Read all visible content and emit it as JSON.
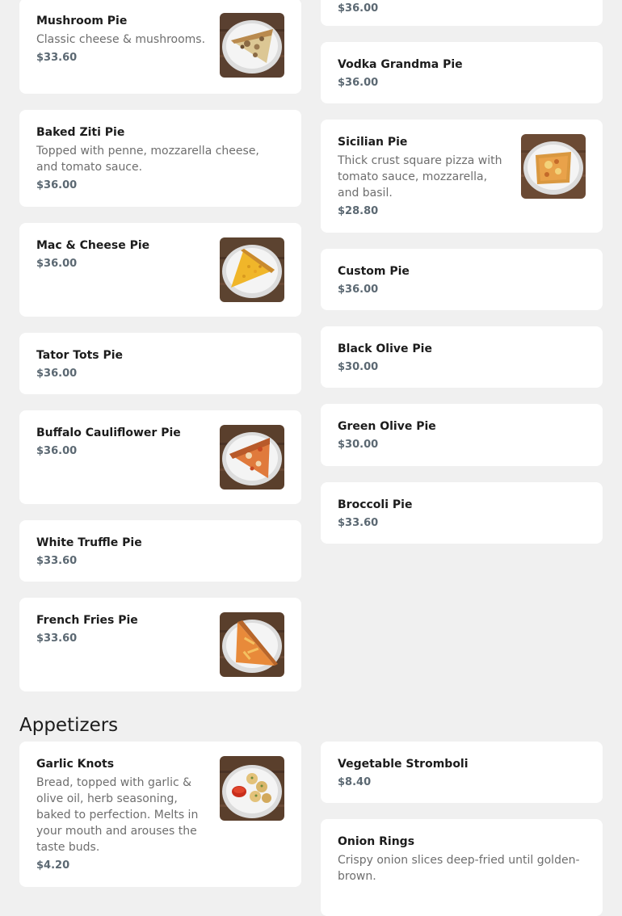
{
  "sections": {
    "pizza": {
      "items": {
        "mushroom": {
          "name": "Mushroom Pie",
          "description": "Classic cheese & mushrooms.",
          "price": "$33.60"
        },
        "baked_ziti": {
          "name": "Baked Ziti Pie",
          "description": "Topped with penne, mozzarella cheese, and tomato sauce.",
          "price": "$36.00"
        },
        "mac_cheese": {
          "name": "Mac & Cheese Pie",
          "price": "$36.00"
        },
        "tator_tots": {
          "name": "Tator Tots Pie",
          "price": "$36.00"
        },
        "buffalo_cauliflower": {
          "name": "Buffalo Cauliflower Pie",
          "price": "$36.00"
        },
        "white_truffle": {
          "name": "White Truffle Pie",
          "price": "$33.60"
        },
        "french_fries": {
          "name": "French Fries Pie",
          "price": "$33.60"
        },
        "partial_top_card": {
          "price": "$36.00"
        },
        "vodka_grandma": {
          "name": "Vodka Grandma Pie",
          "price": "$36.00"
        },
        "sicilian": {
          "name": "Sicilian Pie",
          "description": "Thick crust square pizza with tomato sauce, mozzarella, and basil.",
          "price": "$28.80"
        },
        "custom": {
          "name": "Custom Pie",
          "price": "$36.00"
        },
        "black_olive": {
          "name": "Black Olive Pie",
          "price": "$30.00"
        },
        "green_olive": {
          "name": "Green Olive Pie",
          "price": "$30.00"
        },
        "broccoli": {
          "name": "Broccoli Pie",
          "price": "$33.60"
        }
      }
    },
    "appetizers": {
      "title": "Appetizers",
      "items": {
        "garlic_knots": {
          "name": "Garlic Knots",
          "description": "Bread, topped with garlic & olive oil, herb seasoning, baked to perfection. Melts in your mouth and arouses the taste buds.",
          "price": "$4.20"
        },
        "vegetable_stromboli": {
          "name": "Vegetable Stromboli",
          "price": "$8.40"
        },
        "onion_rings": {
          "name": "Onion Rings",
          "description": "Crispy onion slices deep-fried until golden-brown."
        }
      }
    }
  },
  "icons": {
    "mushroom_pie": "mushroom-pizza-slice-photo",
    "mac_cheese_pie": "mac-cheese-pizza-slice-photo",
    "buffalo_cauliflower_pie": "buffalo-pizza-slice-photo",
    "french_fries_pie": "fries-pizza-slice-photo",
    "sicilian_pie": "sicilian-pizza-slice-photo",
    "garlic_knots": "garlic-knots-photo"
  },
  "colors": {
    "background": "#f0f0f0",
    "card": "#ffffff",
    "item_name": "#1c1c1c",
    "description": "#6e6e6e",
    "price": "#5b6872"
  }
}
